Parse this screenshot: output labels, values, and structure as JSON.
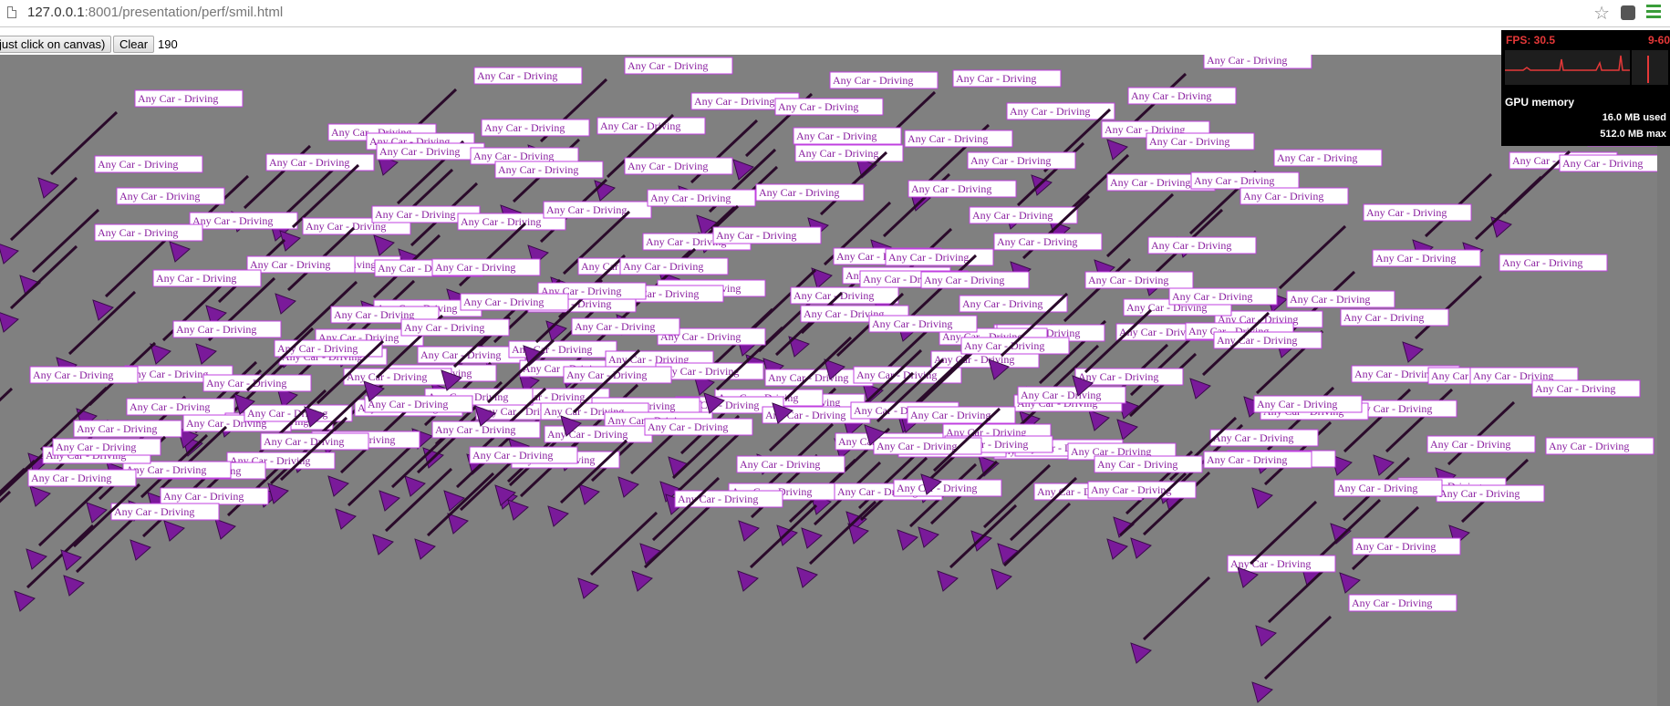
{
  "browser": {
    "url_host": "127.0.0.1",
    "url_rest": ":8001/presentation/perf/smil.html",
    "star_icon": "bookmark-star-icon",
    "menu_icon": "hamburger-menu-icon"
  },
  "toolbar": {
    "add_button_label": "just click on canvas)",
    "clear_button_label": "Clear",
    "object_count": "190"
  },
  "canvas": {
    "car_label": "Any Car - Driving",
    "colors": {
      "background": "#808080",
      "car_body": "#7a1a9a",
      "label_border": "#c040e0",
      "label_text": "#8a1fa0",
      "path_line": "#2a0a2a"
    }
  },
  "hud": {
    "fps_text": "FPS: 30.5",
    "fps_range": "9-60",
    "gpu_title": "GPU memory",
    "gpu_used": "16.0 MB used",
    "gpu_max": "512.0 MB max"
  }
}
